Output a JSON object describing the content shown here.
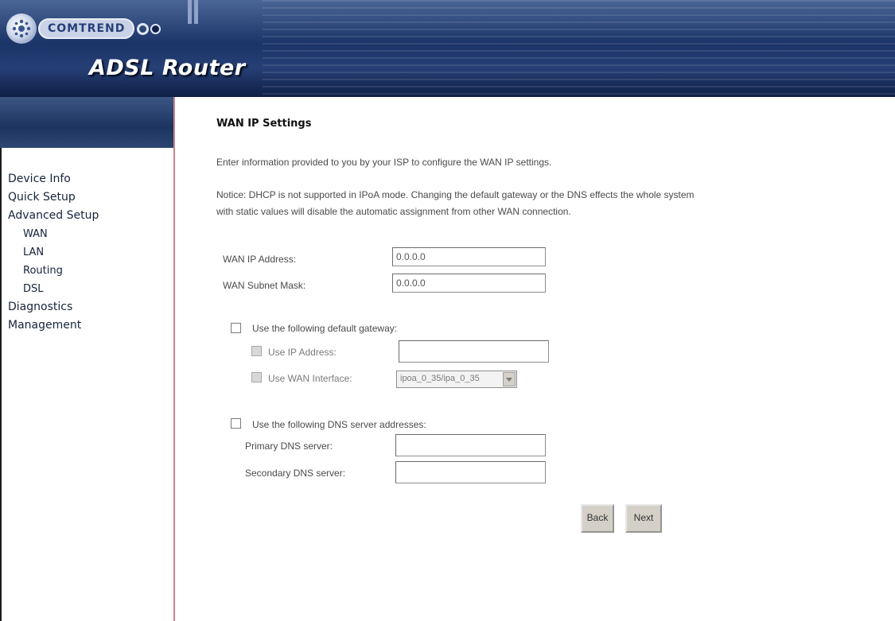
{
  "header": {
    "brand": "COMTREND",
    "product_title": "ADSL Router"
  },
  "sidebar": {
    "items": [
      {
        "label": "Device Info"
      },
      {
        "label": "Quick Setup"
      },
      {
        "label": "Advanced Setup"
      },
      {
        "label": "WAN"
      },
      {
        "label": "LAN"
      },
      {
        "label": "Routing"
      },
      {
        "label": "DSL"
      },
      {
        "label": "Diagnostics"
      },
      {
        "label": "Management"
      }
    ]
  },
  "main": {
    "title": "WAN IP Settings",
    "intro": "Enter information provided to you by your ISP to configure the WAN IP settings.",
    "notice_line1": "Notice: DHCP is not supported in IPoA mode. Changing the default gateway or the DNS effects the whole system",
    "notice_line2": "with static values will disable the automatic assignment from other WAN connection.",
    "wan_ip_label": "WAN IP Address:",
    "wan_ip_value": "0.0.0.0",
    "wan_mask_label": "WAN Subnet Mask:",
    "wan_mask_value": "0.0.0.0",
    "gateway": {
      "checkbox_label": "Use the following default gateway:",
      "use_ip_label": "Use IP Address:",
      "use_ip_value": "",
      "use_wan_label": "Use WAN Interface:",
      "wan_interface_selected": "ipoa_0_35/ipa_0_35"
    },
    "dns": {
      "checkbox_label": "Use the following DNS server addresses:",
      "primary_label": "Primary DNS server:",
      "primary_value": "",
      "secondary_label": "Secondary DNS server:",
      "secondary_value": ""
    },
    "buttons": {
      "back": "Back",
      "next": "Next"
    }
  }
}
